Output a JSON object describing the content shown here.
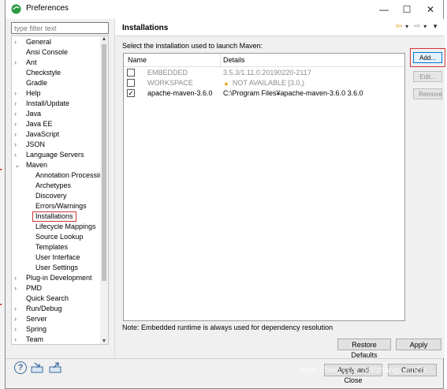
{
  "window": {
    "title": "Preferences",
    "controls": {
      "minimize": "—",
      "maximize": "☐",
      "close": "✕"
    }
  },
  "filter": {
    "placeholder": "type filter text",
    "value": ""
  },
  "tree": {
    "items": [
      {
        "label": "General",
        "level": 0,
        "expandable": true
      },
      {
        "label": "Ansi Console",
        "level": 0,
        "expandable": false
      },
      {
        "label": "Ant",
        "level": 0,
        "expandable": true
      },
      {
        "label": "Checkstyle",
        "level": 0,
        "expandable": false
      },
      {
        "label": "Gradle",
        "level": 0,
        "expandable": false
      },
      {
        "label": "Help",
        "level": 0,
        "expandable": true
      },
      {
        "label": "Install/Update",
        "level": 0,
        "expandable": true
      },
      {
        "label": "Java",
        "level": 0,
        "expandable": true
      },
      {
        "label": "Java EE",
        "level": 0,
        "expandable": true
      },
      {
        "label": "JavaScript",
        "level": 0,
        "expandable": true
      },
      {
        "label": "JSON",
        "level": 0,
        "expandable": true
      },
      {
        "label": "Language Servers",
        "level": 0,
        "expandable": true
      },
      {
        "label": "Maven",
        "level": 0,
        "expandable": true,
        "expanded": true
      },
      {
        "label": "Annotation Processin",
        "level": 1,
        "expandable": false
      },
      {
        "label": "Archetypes",
        "level": 1,
        "expandable": false
      },
      {
        "label": "Discovery",
        "level": 1,
        "expandable": false
      },
      {
        "label": "Errors/Warnings",
        "level": 1,
        "expandable": false
      },
      {
        "label": "Installations",
        "level": 1,
        "expandable": false,
        "selected": true
      },
      {
        "label": "Lifecycle Mappings",
        "level": 1,
        "expandable": false
      },
      {
        "label": "Source Lookup",
        "level": 1,
        "expandable": false
      },
      {
        "label": "Templates",
        "level": 1,
        "expandable": false
      },
      {
        "label": "User Interface",
        "level": 1,
        "expandable": false
      },
      {
        "label": "User Settings",
        "level": 1,
        "expandable": false
      },
      {
        "label": "Plug-in Development",
        "level": 0,
        "expandable": true
      },
      {
        "label": "PMD",
        "level": 0,
        "expandable": true
      },
      {
        "label": "Quick Search",
        "level": 0,
        "expandable": false
      },
      {
        "label": "Run/Debug",
        "level": 0,
        "expandable": true
      },
      {
        "label": "Server",
        "level": 0,
        "expandable": true
      },
      {
        "label": "Spring",
        "level": 0,
        "expandable": true
      },
      {
        "label": "Team",
        "level": 0,
        "expandable": true
      }
    ]
  },
  "page": {
    "title": "Installations",
    "description": "Select the installation used to launch Maven:",
    "columns": {
      "name": "Name",
      "details": "Details"
    },
    "rows": [
      {
        "checked": false,
        "disabled": true,
        "warning": false,
        "name": "EMBEDDED",
        "details": "3.5.3/1.11.0.20190220-2117"
      },
      {
        "checked": false,
        "disabled": true,
        "warning": true,
        "name": "WORKSPACE",
        "details": "NOT AVAILABLE [3.0,)"
      },
      {
        "checked": true,
        "disabled": false,
        "warning": false,
        "name": "apache-maven-3.6.0",
        "details": "C:\\Program Files¥apache-maven-3.6.0 3.6.0"
      }
    ],
    "buttons": {
      "add": "Add...",
      "edit": "Edit...",
      "remove": "Remove"
    },
    "note": "Note: Embedded runtime is always used for dependency resolution",
    "restore_defaults": "Restore Defaults",
    "apply": "Apply"
  },
  "footer": {
    "apply_close": "Apply and Close",
    "cancel": "Cancel",
    "watermark": "https://blog.csdn.net/zhangyuanzhi..."
  },
  "colors": {
    "highlight_box": "#d0363a",
    "nav_arrow": "#d99800",
    "primary_border": "#0078d7"
  }
}
